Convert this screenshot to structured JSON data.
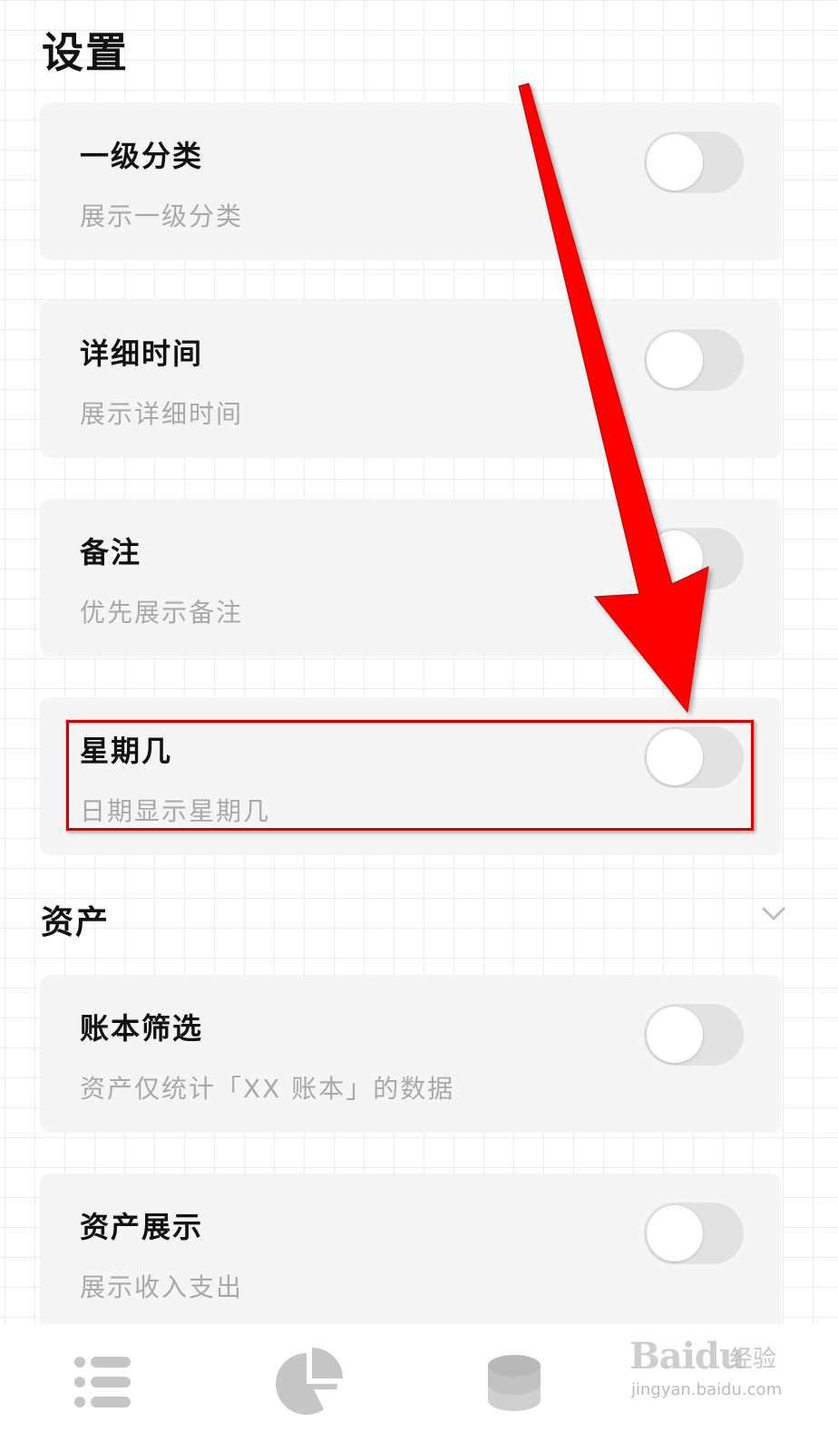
{
  "page": {
    "title": "设置"
  },
  "display_settings": [
    {
      "title": "一级分类",
      "subtitle": "展示一级分类",
      "enabled": false
    },
    {
      "title": "详细时间",
      "subtitle": "展示详细时间",
      "enabled": false
    },
    {
      "title": "备注",
      "subtitle": "优先展示备注",
      "enabled": false
    },
    {
      "title": "星期几",
      "subtitle": "日期显示星期几",
      "enabled": false
    }
  ],
  "asset_section": {
    "title": "资产",
    "expanded": true,
    "items": [
      {
        "title": "账本筛选",
        "subtitle": "资产仅统计「XX 账本」的数据",
        "enabled": false
      },
      {
        "title": "资产展示",
        "subtitle": "展示收入支出",
        "enabled": false
      }
    ]
  },
  "bottom_nav": [
    {
      "icon": "list-icon"
    },
    {
      "icon": "pie-chart-icon"
    },
    {
      "icon": "coins-stack-icon"
    }
  ],
  "watermark": {
    "logo_text": "Baidu",
    "cn_text": "经验",
    "url": "jingyan.baidu.com"
  },
  "colors": {
    "card_bg": "#f5f5f5",
    "toggle_off": "#e2e2e2",
    "annotation_red": "#ff0000",
    "title_text": "#111111",
    "subtitle_text": "#a9a9a9"
  }
}
